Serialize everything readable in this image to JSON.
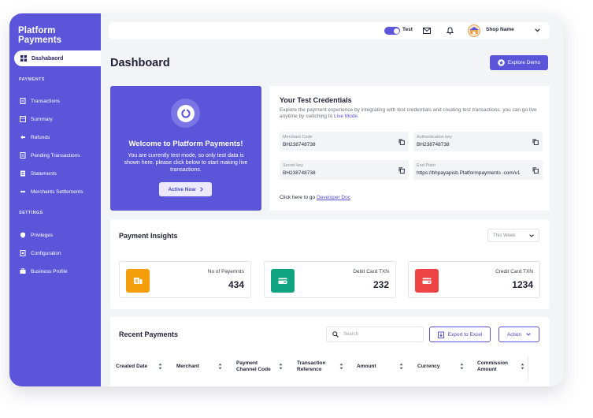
{
  "sidebar": {
    "brand": "Platform Payments",
    "active_item": "Dashabaord",
    "payments_label": "PAYMENTS",
    "payments_items": [
      "Transactions",
      "Summary",
      "Refunds",
      "Pending Transactions",
      "Statements",
      "Merchants Settlements"
    ],
    "settings_label": "SETTINGS",
    "settings_items": [
      "Privileges",
      "Configuration",
      "Business Profile"
    ]
  },
  "topbar": {
    "mode_label": "Test",
    "mode_on": true,
    "shop_name": "Shop Name"
  },
  "page": {
    "title": "Dashboard",
    "explore_label": "Explore Demo"
  },
  "welcome": {
    "title": "Welcome to Platform Payments!",
    "text": "You are currently test mode, so only test data is shown here. please click below to start making live transactions.",
    "button": "Active Now"
  },
  "credentials": {
    "title": "Your Test Credentials",
    "desc": "Explore the payment experience by integrating with test credentials and creating test transactions. you can go live anytime by switching to",
    "desc_link": "Live Mode.",
    "fields": [
      {
        "label": "Merchant Code",
        "value": "BH238748738"
      },
      {
        "label": "Authentication key",
        "value": "BH238748738"
      },
      {
        "label": "Secret key",
        "value": "BH238748738"
      },
      {
        "label": "End Point",
        "value": "https://bhpayapisb.Platformpayments .com/v1"
      }
    ],
    "doc_text": "Click here to go",
    "doc_link": "Developer Doc"
  },
  "insights": {
    "title": "Payment Insights",
    "period": "This Week",
    "stats": [
      {
        "label": "No of Payemnts",
        "value": "434",
        "color": "#f59e0b"
      },
      {
        "label": "Debit Card TXN",
        "value": "232",
        "color": "#10a37f"
      },
      {
        "label": "Credit Card TXN",
        "value": "1234",
        "color": "#ef4444"
      }
    ]
  },
  "recent": {
    "title": "Recent Payments",
    "search_placeholder": "Search",
    "export_label": "Export to Excel",
    "action_label": "Action",
    "columns": [
      "Created Date",
      "Merchant",
      "Payment Channel Code",
      "Transaction Reference",
      "Amount",
      "Currency",
      "Commission Amount"
    ]
  },
  "colors": {
    "accent": "#5a55d9",
    "background": "#f3f4f8"
  }
}
